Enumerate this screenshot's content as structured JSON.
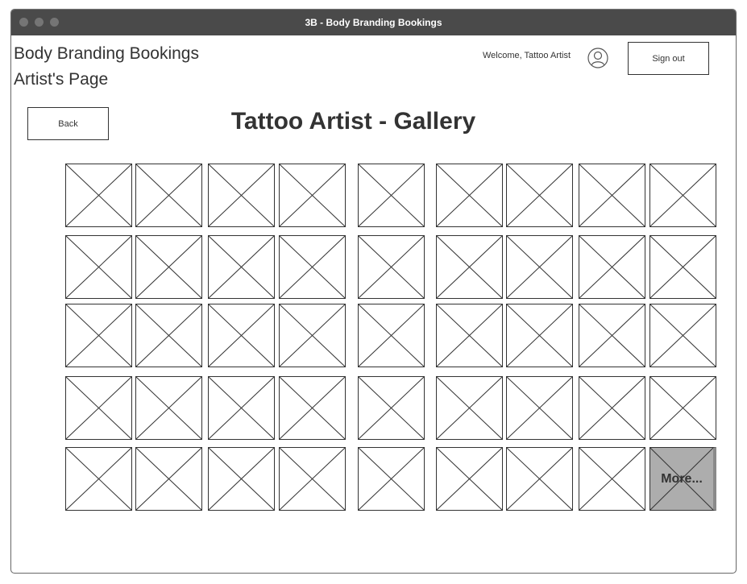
{
  "window": {
    "title": "3B - Body Branding Bookings"
  },
  "header": {
    "brand_line1": "Body Branding Bookings",
    "brand_line2": "Artist's Page",
    "welcome": "Welcome, Tattoo Artist",
    "user_icon": "user-avatar-icon",
    "sign_out_label": "Sign out"
  },
  "nav": {
    "back_label": "Back"
  },
  "page": {
    "heading": "Tattoo Artist - Gallery"
  },
  "gallery": {
    "rows": 5,
    "columns": 9,
    "image_placeholder": "image-placeholder-icon",
    "more_label": "More..."
  },
  "colors": {
    "titlebar": "#4a4a4a",
    "more_tile": "#adadad"
  }
}
